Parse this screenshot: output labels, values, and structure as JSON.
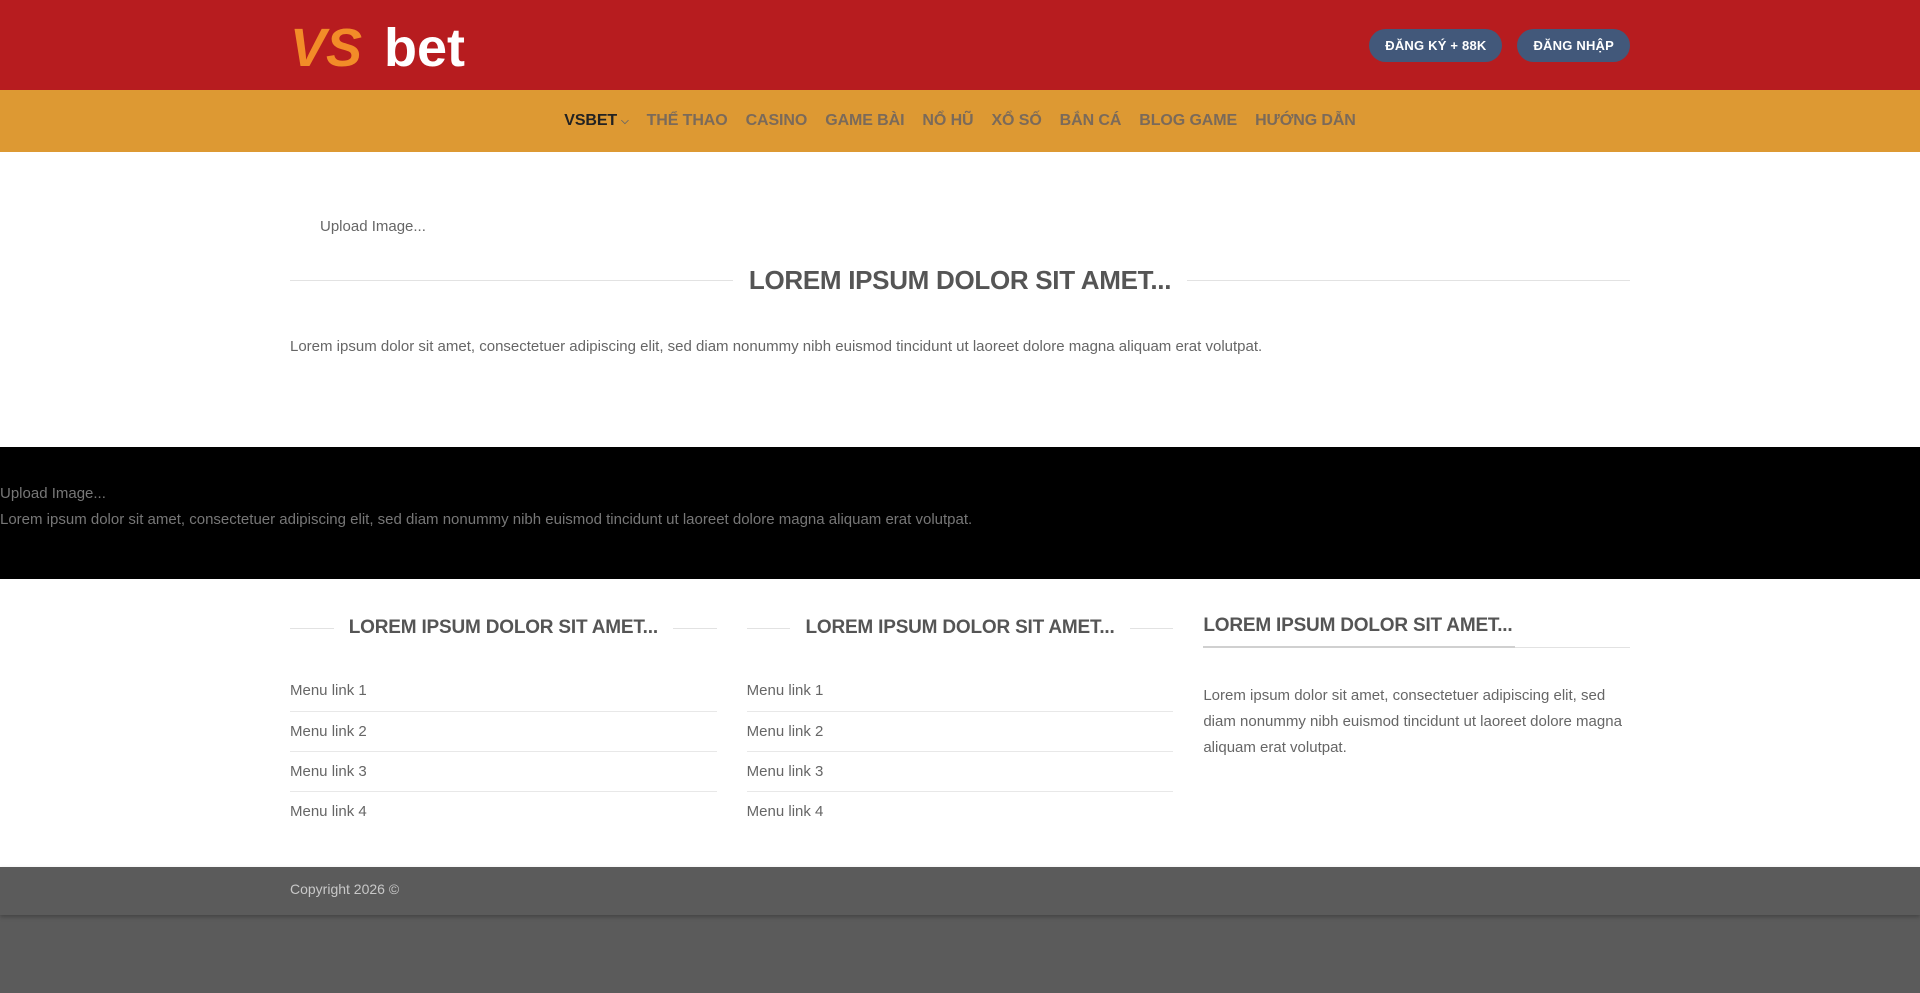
{
  "header": {
    "logo_text_vs": "VS",
    "logo_text_bet": "bet",
    "buttons": {
      "register": "ĐĂNG KÝ + 88K",
      "login": "ĐĂNG NHẬP"
    },
    "colors": {
      "header_bg": "#b71c1f",
      "nav_bg": "#dd9933",
      "button_bg": "#42587a",
      "logo_orange": "#f28c28"
    }
  },
  "nav": {
    "items": [
      {
        "label": "VSBET"
      },
      {
        "label": "THỂ THAO"
      },
      {
        "label": "CASINO"
      },
      {
        "label": "GAME BÀI"
      },
      {
        "label": "NỔ HŨ"
      },
      {
        "label": "XỔ SỐ"
      },
      {
        "label": "BẮN CÁ"
      },
      {
        "label": "BLOG GAME"
      },
      {
        "label": "HƯỚNG DẪN"
      }
    ],
    "dropdown_icon": "chevron-down-icon"
  },
  "main": {
    "upload_text": "Upload Image...",
    "title": "LOREM IPSUM DOLOR SIT AMET...",
    "text": "Lorem ipsum dolor sit amet, consectetuer adipiscing elit, sed diam nonummy nibh euismod tincidunt ut laoreet dolore magna aliquam erat volutpat."
  },
  "black_section": {
    "upload_text": "Upload Image...",
    "text": "Lorem ipsum dolor sit amet, consectetuer adipiscing elit, sed diam nonummy nibh euismod tincidunt ut laoreet dolore magna aliquam erat volutpat."
  },
  "footer": {
    "col1": {
      "title": "LOREM IPSUM DOLOR SIT AMET...",
      "links": [
        "Menu link 1",
        "Menu link 2",
        "Menu link 3",
        "Menu link 4"
      ]
    },
    "col2": {
      "title": "LOREM IPSUM DOLOR SIT AMET...",
      "links": [
        "Menu link 1",
        "Menu link 2",
        "Menu link 3",
        "Menu link 4"
      ]
    },
    "col3": {
      "title": "LOREM IPSUM DOLOR SIT AMET...",
      "text": "Lorem ipsum dolor sit amet, consectetuer adipiscing elit, sed diam nonummy nibh euismod tincidunt ut laoreet dolore magna aliquam erat volutpat."
    },
    "copyright": "Copyright 2026 ©"
  }
}
